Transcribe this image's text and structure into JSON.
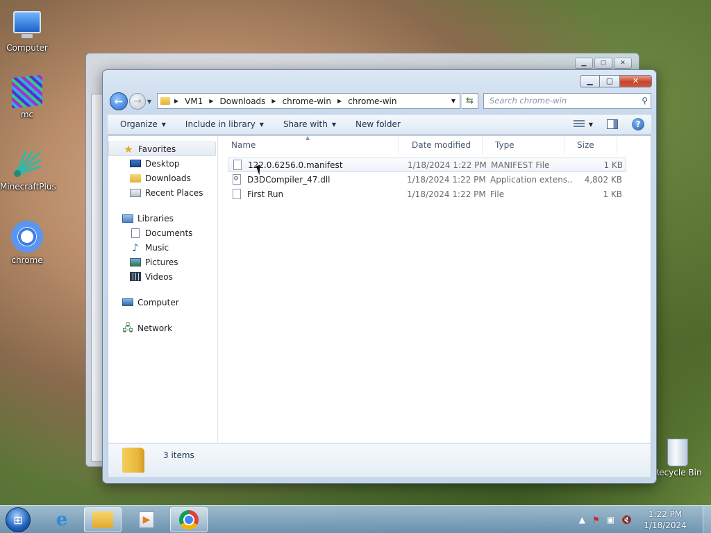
{
  "desktop": {
    "icons": [
      {
        "label": "Computer"
      },
      {
        "label": "mc"
      },
      {
        "label": "MinecraftPlus"
      },
      {
        "label": "chrome"
      }
    ],
    "recycle_bin": "Recycle Bin"
  },
  "window": {
    "address": {
      "crumbs": [
        "VM1",
        "Downloads",
        "chrome-win",
        "chrome-win"
      ]
    },
    "search_placeholder": "Search chrome-win",
    "toolbar": {
      "organize": "Organize",
      "include_in_library": "Include in library",
      "share_with": "Share with",
      "new_folder": "New folder"
    },
    "nav": {
      "favorites": "Favorites",
      "desktop": "Desktop",
      "downloads": "Downloads",
      "recent_places": "Recent Places",
      "libraries": "Libraries",
      "documents": "Documents",
      "music": "Music",
      "pictures": "Pictures",
      "videos": "Videos",
      "computer": "Computer",
      "network": "Network"
    },
    "columns": {
      "name": "Name",
      "date_modified": "Date modified",
      "type": "Type",
      "size": "Size"
    },
    "files": [
      {
        "name": "122.0.6256.0.manifest",
        "date": "1/18/2024 1:22 PM",
        "type": "MANIFEST File",
        "size": "1 KB"
      },
      {
        "name": "D3DCompiler_47.dll",
        "date": "1/18/2024 1:22 PM",
        "type": "Application extens...",
        "size": "4,802 KB"
      },
      {
        "name": "First Run",
        "date": "1/18/2024 1:22 PM",
        "type": "File",
        "size": "1 KB"
      }
    ],
    "status": "3 items"
  },
  "taskbar": {
    "time": "1:22 PM",
    "date": "1/18/2024"
  }
}
